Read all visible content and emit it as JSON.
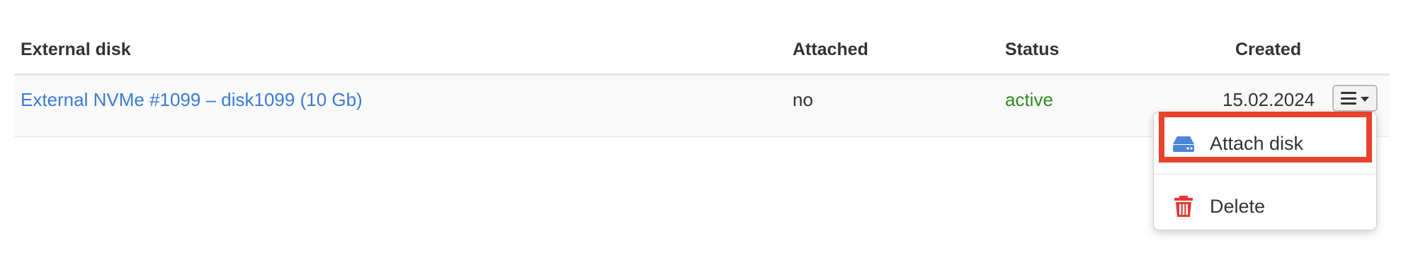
{
  "table": {
    "headers": {
      "disk": "External disk",
      "attached": "Attached",
      "status": "Status",
      "created": "Created"
    },
    "rows": [
      {
        "disk": "External NVMe #1099 – disk1099 (10 Gb)",
        "attached": "no",
        "status": "active",
        "created": "15.02.2024"
      }
    ]
  },
  "row_menu": {
    "button_icon": "hamburger-menu-icon",
    "items": [
      {
        "label": "Attach disk",
        "icon": "disk-drive-icon",
        "highlighted": true
      },
      {
        "label": "Delete",
        "icon": "trash-icon"
      }
    ]
  },
  "colors": {
    "link": "#3a7bd5",
    "status_active": "#2e8b1e",
    "delete_icon": "#e53935",
    "highlight_box": "#e8432d"
  }
}
